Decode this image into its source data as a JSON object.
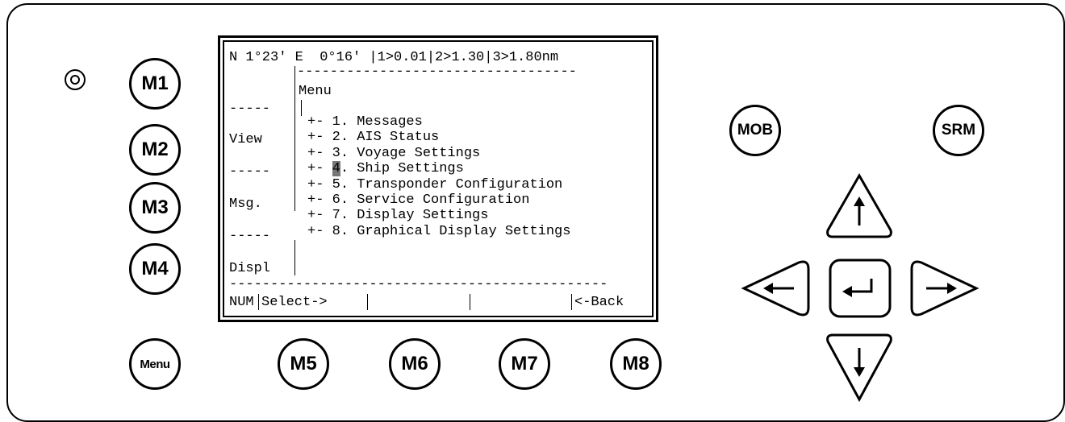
{
  "device": {
    "soft_keys_left": [
      "M1",
      "M2",
      "M3",
      "M4"
    ],
    "menu_key": "Menu",
    "soft_keys_bottom": [
      "M5",
      "M6",
      "M7",
      "M8"
    ],
    "mob_key": "MOB",
    "srm_key": "SRM",
    "nav_icons": [
      "arrow-up-icon",
      "arrow-left-icon",
      "enter-icon",
      "arrow-right-icon",
      "arrow-down-icon"
    ]
  },
  "lcd": {
    "status_line": "N 1°23' E  0°16' |1>0.01|2>1.30|3>1.80nm",
    "left_labels": [
      "-----",
      "View",
      "-----",
      "Msg.",
      "-----",
      "Displ"
    ],
    "menu_title": "Menu",
    "items": [
      {
        "prefix": "+- ",
        "num": "1",
        "text": ". Messages"
      },
      {
        "prefix": "+- ",
        "num": "2",
        "text": ". AIS Status"
      },
      {
        "prefix": "+- ",
        "num": "3",
        "text": ". Voyage Settings"
      },
      {
        "prefix": "+- ",
        "num": "4",
        "text": ". Ship Settings",
        "selected": true
      },
      {
        "prefix": "+- ",
        "num": "5",
        "text": ". Transponder Configuration"
      },
      {
        "prefix": "+- ",
        "num": "6",
        "text": ". Service Configuration"
      },
      {
        "prefix": "+- ",
        "num": "7",
        "text": ". Display Settings"
      },
      {
        "prefix": "+- ",
        "num": "8",
        "text": ". Graphical Display Settings"
      }
    ],
    "softkey_bar": {
      "num": "NUM",
      "select": "Select->",
      "back": "<-Back"
    }
  }
}
